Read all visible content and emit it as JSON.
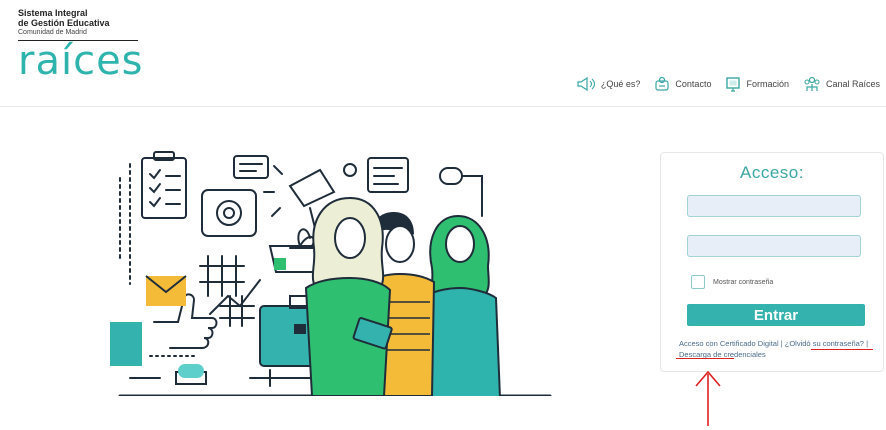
{
  "brand": {
    "line1": "Sistema Integral",
    "line2": "de Gestión Educativa",
    "line3": "Comunidad de Madrid",
    "logo": "raíces"
  },
  "nav": {
    "items": [
      {
        "label": "¿Qué es?",
        "icon": "megaphone-icon"
      },
      {
        "label": "Contacto",
        "icon": "contact-icon"
      },
      {
        "label": "Formación",
        "icon": "monitor-icon"
      },
      {
        "label": "Canal Raíces",
        "icon": "people-icon"
      }
    ]
  },
  "login": {
    "title": "Acceso:",
    "user_value": "",
    "password_value": "",
    "show_password_label": "Mostrar contraseña",
    "submit_label": "Entrar",
    "cert_link": "Acceso con Certificado Digital",
    "separator1": " | ",
    "forgot_link": "¿Olvidó su contraseña?",
    "separator2": " | ",
    "download_link": "Descarga de credenciales"
  },
  "colors": {
    "accent": "#34b3ae",
    "field_bg": "#e8eef8",
    "annotation": "#dd2222"
  }
}
